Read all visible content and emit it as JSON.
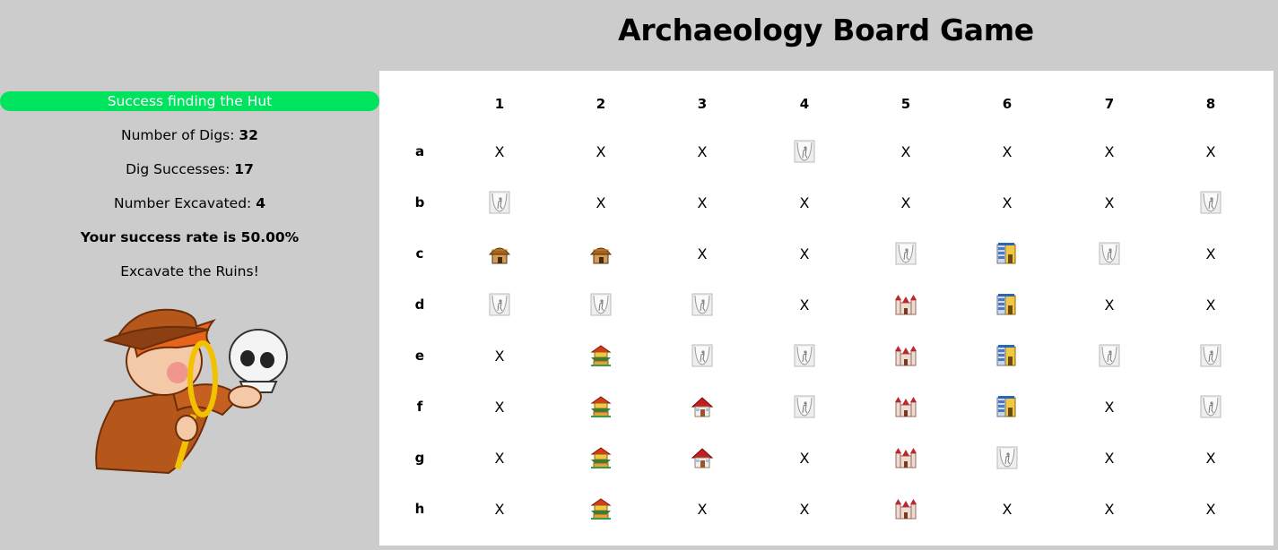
{
  "title": "Archaeology Board Game",
  "sidebar": {
    "banner": "Success finding the Hut",
    "digs_label": "Number of Digs: ",
    "digs_value": "32",
    "successes_label": "Dig Successes: ",
    "successes_value": "17",
    "excavated_label": "Number Excavated: ",
    "excavated_value": "4",
    "success_rate": "Your success rate is 50.00%",
    "instruction": "Excavate the Ruins!",
    "mascot_icon": "explorer-with-magnifier-and-skull-icon"
  },
  "board": {
    "columns": [
      "1",
      "2",
      "3",
      "4",
      "5",
      "6",
      "7",
      "8"
    ],
    "rows": [
      {
        "label": "a",
        "cells": [
          "X",
          "X",
          "X",
          "dug",
          "X",
          "X",
          "X",
          "X"
        ]
      },
      {
        "label": "b",
        "cells": [
          "dug",
          "X",
          "X",
          "X",
          "X",
          "X",
          "X",
          "dug"
        ]
      },
      {
        "label": "c",
        "cells": [
          "hut",
          "hut",
          "X",
          "X",
          "dug",
          "building",
          "dug",
          "X"
        ]
      },
      {
        "label": "d",
        "cells": [
          "dug",
          "dug",
          "dug",
          "X",
          "castle",
          "building",
          "X",
          "X"
        ]
      },
      {
        "label": "e",
        "cells": [
          "X",
          "temple",
          "dug",
          "dug",
          "castle",
          "building",
          "dug",
          "dug"
        ]
      },
      {
        "label": "f",
        "cells": [
          "X",
          "temple",
          "house",
          "dug",
          "castle",
          "building",
          "X",
          "dug"
        ]
      },
      {
        "label": "g",
        "cells": [
          "X",
          "temple",
          "house",
          "X",
          "castle",
          "dug",
          "X",
          "X"
        ]
      },
      {
        "label": "h",
        "cells": [
          "X",
          "temple",
          "X",
          "X",
          "castle",
          "X",
          "X",
          "X"
        ]
      }
    ],
    "empty_symbol": "X"
  },
  "icons": {
    "dug": "excavated-hole-icon",
    "hut": "hut-icon",
    "building": "shop-building-icon",
    "castle": "castle-icon",
    "temple": "temple-icon",
    "house": "house-icon"
  },
  "colors": {
    "background": "#cccccc",
    "banner": "#00e35f",
    "board": "#ffffff"
  }
}
